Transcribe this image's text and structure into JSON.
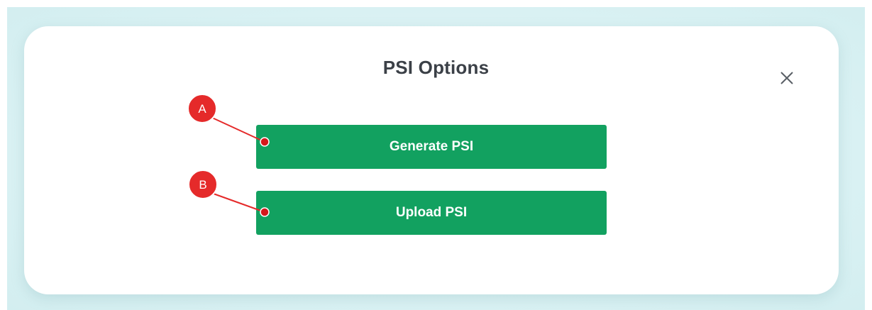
{
  "dialog": {
    "title": "PSI Options",
    "close_icon": "close-icon",
    "buttons": [
      {
        "label": "Generate PSI"
      },
      {
        "label": "Upload PSI"
      }
    ]
  },
  "annotations": [
    {
      "letter": "A"
    },
    {
      "letter": "B"
    }
  ],
  "colors": {
    "backdrop": "#dcf3f5",
    "modal": "#ffffff",
    "title": "#3b4047",
    "button": "#12a160",
    "button_text": "#ffffff",
    "annotation": "#e52a2a"
  }
}
